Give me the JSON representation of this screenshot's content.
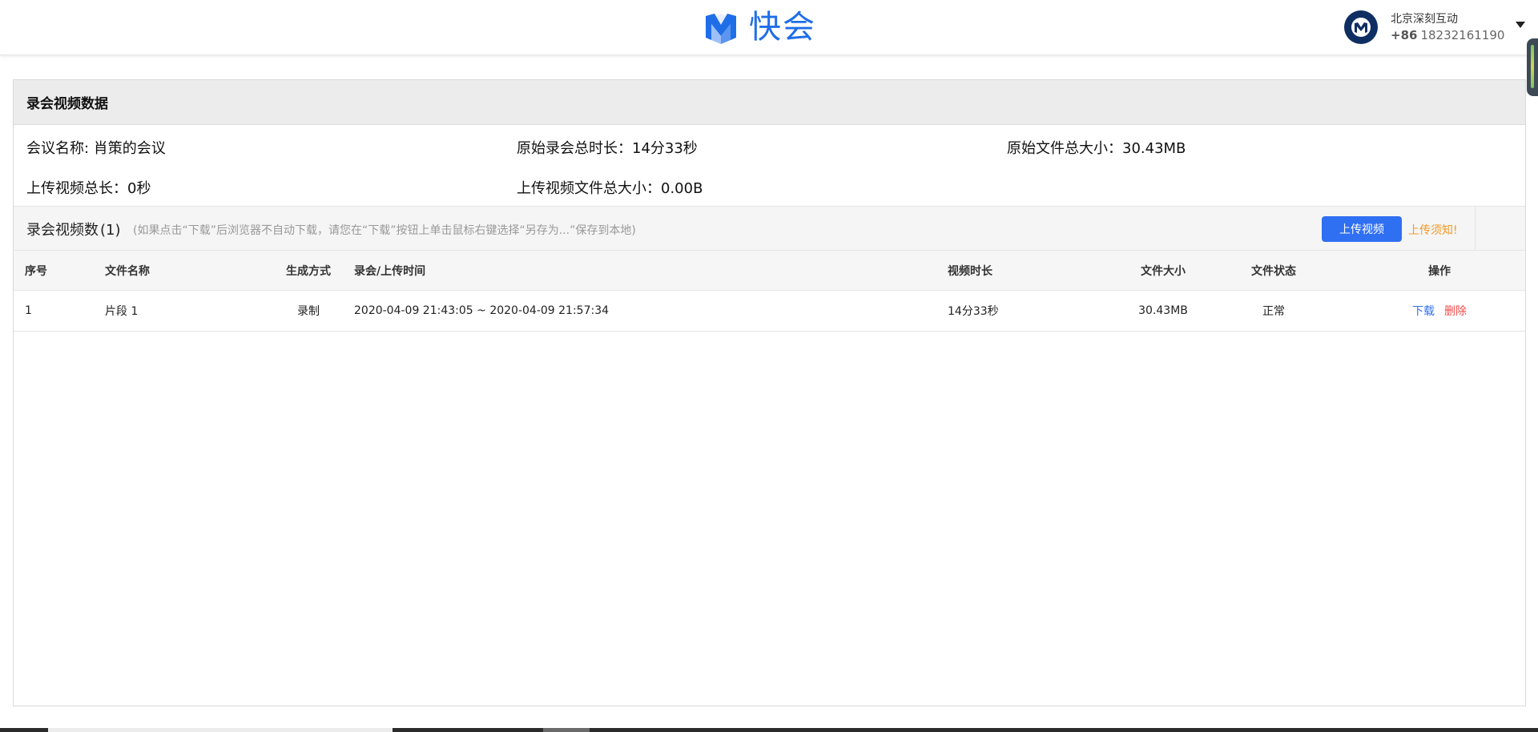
{
  "header": {
    "brand_name": "快会",
    "user": {
      "company": "北京深刻互动",
      "country_code": "+86",
      "phone": "18232161190"
    }
  },
  "panel": {
    "title": "录会视频数据",
    "stats": {
      "meeting_name_label": "会议名称: ",
      "meeting_name_value": "肖策的会议",
      "orig_duration_label": "原始录会总时长：",
      "orig_duration_value": "14分33秒",
      "orig_size_label": "原始文件总大小：",
      "orig_size_value": "30.43MB",
      "upload_duration_label": "上传视频总长：",
      "upload_duration_value": "0秒",
      "upload_size_label": "上传视频文件总大小：",
      "upload_size_value": "0.00B"
    },
    "recordings": {
      "title": "录会视频数",
      "count": "(1)",
      "hint": "(如果点击“下载”后浏览器不自动下载，请您在“下载”按钮上单击鼠标右键选择“另存为...”保存到本地)",
      "upload_button": "上传视频",
      "upload_notice": "上传须知!"
    },
    "table": {
      "columns": {
        "idx": "序号",
        "name": "文件名称",
        "mode": "生成方式",
        "time": "录会/上传时间",
        "duration": "视频时长",
        "size": "文件大小",
        "status": "文件状态",
        "ops": "操作"
      },
      "rows": [
        {
          "idx": "1",
          "name": "片段 1",
          "mode": "录制",
          "time": "2020-04-09 21:43:05 ~ 2020-04-09 21:57:34",
          "duration": "14分33秒",
          "size": "30.43MB",
          "status": "正常",
          "download": "下载",
          "delete": "删除"
        }
      ]
    }
  },
  "colors": {
    "brand": "#1f6ee8",
    "primary_button": "#2f6ff2",
    "notice": "#f29a24",
    "danger": "#f04b4b"
  }
}
